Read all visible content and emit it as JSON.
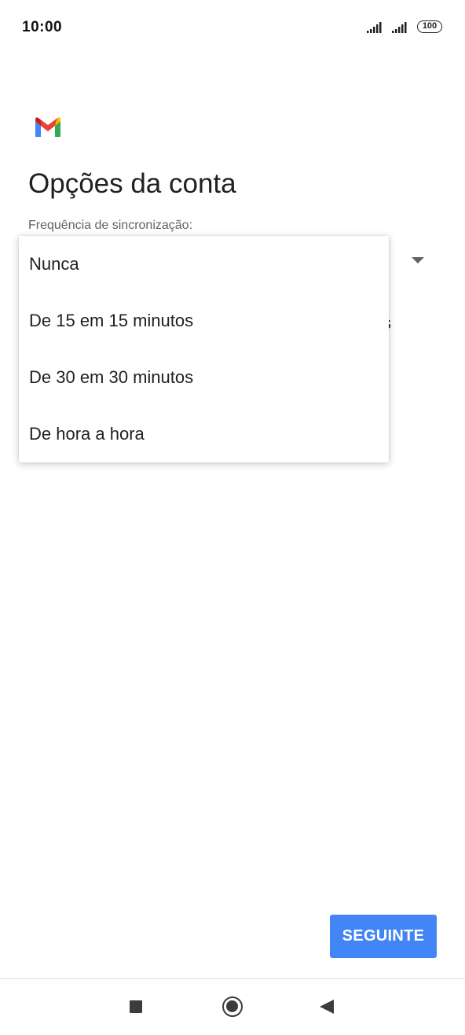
{
  "status_bar": {
    "time": "10:00",
    "battery": "100"
  },
  "header": {
    "logo_icon": "gmail-logo",
    "title": "Opções da conta"
  },
  "sync": {
    "label": "Frequência de sincronização:",
    "peek_text": "s",
    "options": [
      "Nunca",
      "De 15 em 15 minutos",
      "De 30 em 30 minutos",
      "De hora a hora"
    ]
  },
  "footer": {
    "next_label": "SEGUINTE"
  },
  "colors": {
    "accent": "#4285f4",
    "gmail_red": "#ea4335",
    "gmail_blue": "#4285f4",
    "gmail_green": "#34a853",
    "gmail_yellow": "#fbbc04",
    "gmail_darkred": "#c5221f"
  }
}
